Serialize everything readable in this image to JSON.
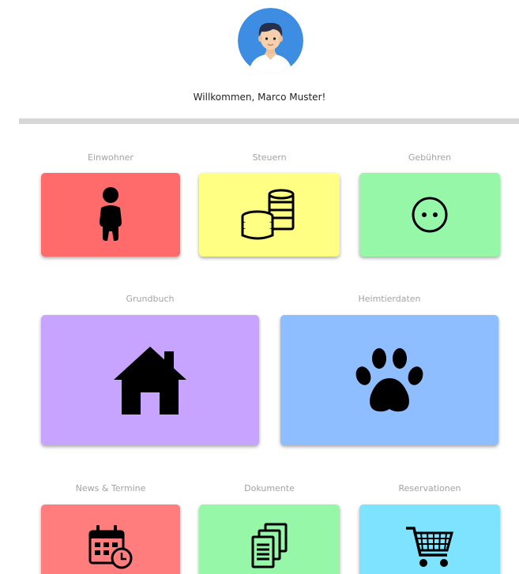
{
  "header": {
    "avatar_icon": "user-avatar-icon",
    "greeting": "Willkommen, Marco Muster!"
  },
  "tiles": {
    "einwohner": {
      "label": "Einwohner",
      "icon": "person-icon",
      "color": "#ff6b6b"
    },
    "steuern": {
      "label": "Steuern",
      "icon": "coins-icon",
      "color": "#ffff84"
    },
    "gebuehren": {
      "label": "Gebühren",
      "icon": "ellipsis-circle-icon",
      "color": "#95f7a7"
    },
    "grundbuch": {
      "label": "Grundbuch",
      "icon": "house-icon",
      "color": "#c7a4ff"
    },
    "heimtierdaten": {
      "label": "Heimtierdaten",
      "icon": "paw-icon",
      "color": "#8ebeff"
    },
    "news": {
      "label": "News & Termine",
      "icon": "calendar-clock-icon",
      "color": "#ff7d7d"
    },
    "dokumente": {
      "label": "Dokumente",
      "icon": "documents-icon",
      "color": "#95f7a7"
    },
    "reservationen": {
      "label": "Reservationen",
      "icon": "shopping-cart-icon",
      "color": "#7ee3ff"
    }
  }
}
